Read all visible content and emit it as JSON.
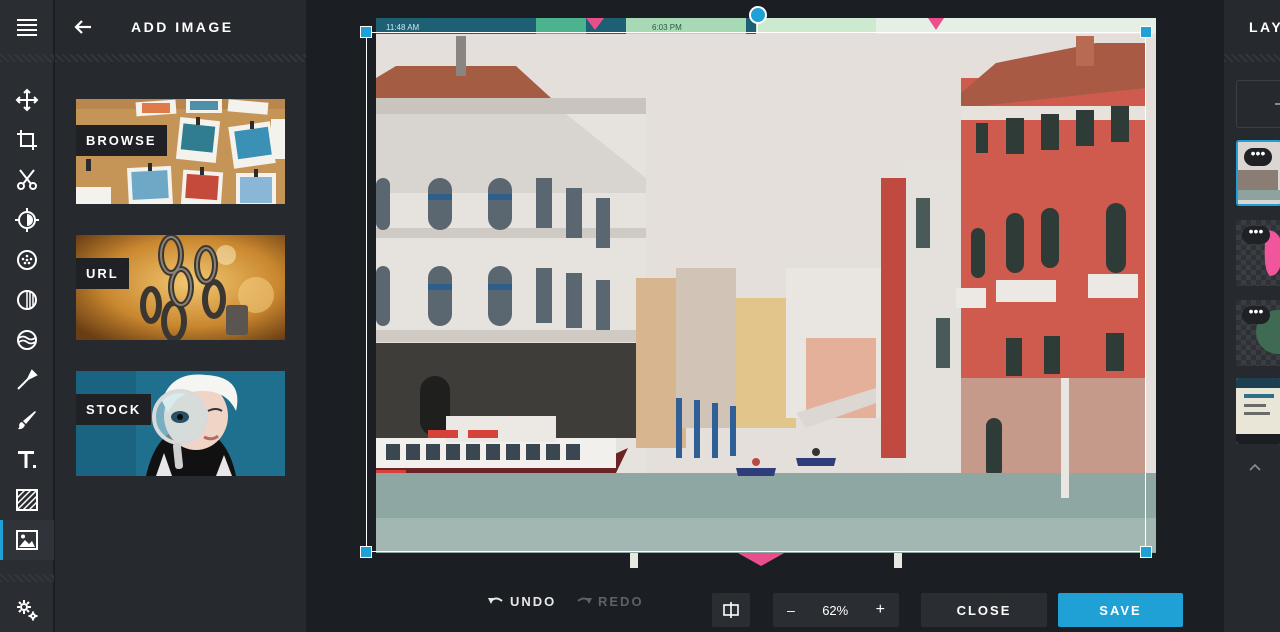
{
  "panel": {
    "title": "ADD IMAGE",
    "sources": [
      {
        "label": "BROWSE"
      },
      {
        "label": "URL"
      },
      {
        "label": "STOCK"
      }
    ]
  },
  "toolbar": {
    "undo_label": "UNDO",
    "redo_label": "REDO",
    "zoom_minus": "–",
    "zoom_level": "62%",
    "zoom_plus": "+",
    "close_label": "CLOSE",
    "save_label": "SAVE"
  },
  "canvas": {
    "status_bar_time_left": "11:48 AM",
    "status_bar_time_mid": "6:03 PM"
  },
  "layers": {
    "title": "LAYERS"
  },
  "icons": [
    "menu-icon",
    "move-icon",
    "crop-icon",
    "cutout-icon",
    "adjust-icon",
    "filter-icon",
    "effects-icon",
    "overlay-icon",
    "retouch-icon",
    "draw-icon",
    "text-icon",
    "texture-icon",
    "add-image-icon",
    "settings-icon",
    "back-arrow-icon",
    "undo-icon",
    "redo-icon",
    "compare-icon",
    "chevron-up-icon"
  ],
  "colors": {
    "accent": "#1fa1d6",
    "rail": "#2a2d32",
    "panel": "#26292e",
    "stage": "#1b1e22"
  }
}
